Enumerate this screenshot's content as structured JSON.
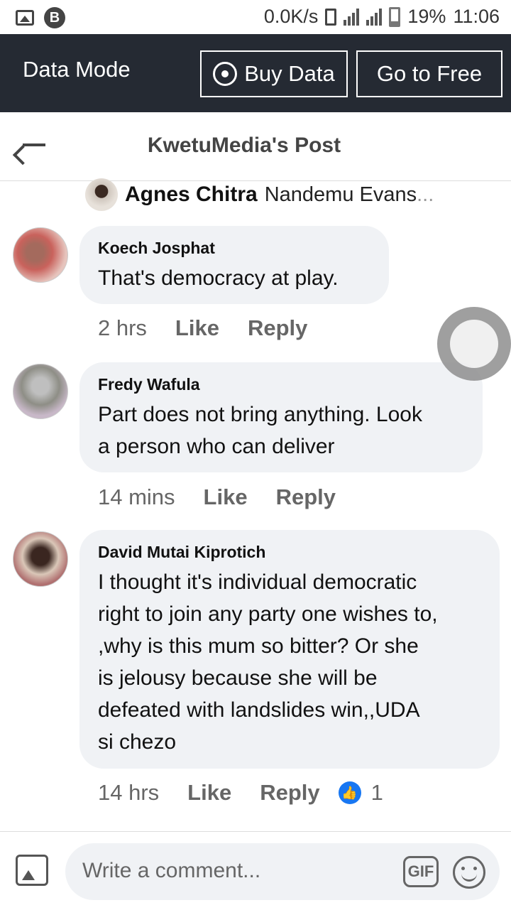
{
  "status_bar": {
    "net_speed": "0.0K/s",
    "battery": "19%",
    "time": "11:06"
  },
  "data_mode": {
    "label": "Data Mode",
    "buy_label": "Buy Data",
    "free_label": "Go to Free"
  },
  "header": {
    "title": "KwetuMedia's Post"
  },
  "reply_preview": {
    "name": "Agnes Chitra",
    "text": "Nandemu Evans",
    "ellipsis": "..."
  },
  "comments": [
    {
      "author": "Koech Josphat",
      "lines": [
        "That's democracy at play."
      ],
      "time": "2 hrs",
      "like": "Like",
      "reply": "Reply"
    },
    {
      "author": "Fredy Wafula",
      "lines": [
        "Part does not bring anything. Look",
        "a person who can deliver"
      ],
      "time": "14 mins",
      "like": "Like",
      "reply": "Reply"
    },
    {
      "author": "David Mutai Kiprotich",
      "lines": [
        "I thought it's individual democratic",
        "right to join any party one wishes to,",
        ",why is this mum so bitter? Or she",
        "is jelousy because she will be",
        "defeated with landslides win,,UDA",
        "si chezo"
      ],
      "time": "14 hrs",
      "like": "Like",
      "reply": "Reply",
      "reaction_count": "1"
    }
  ],
  "composer": {
    "placeholder": "Write a comment...",
    "gif_label": "GIF"
  },
  "colors": {
    "data_bar_bg": "#252a33",
    "bubble_bg": "#f0f2f5",
    "like_blue": "#1877f2"
  }
}
